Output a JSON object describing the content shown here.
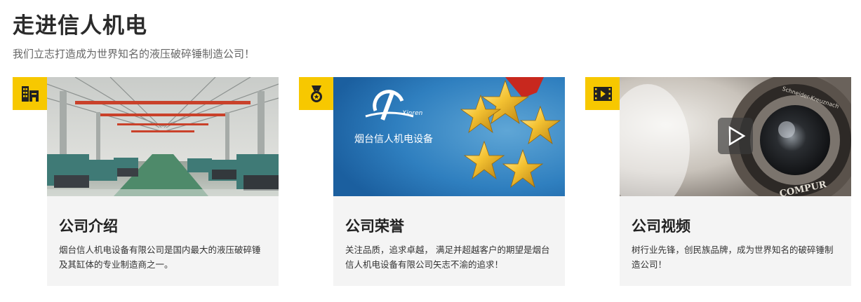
{
  "header": {
    "title": "走进信人机电",
    "subtitle": "我们立志打造成为世界知名的液压破碎锤制造公司！"
  },
  "cards": [
    {
      "icon": "building-icon",
      "image": "factory-floor-photo",
      "title": "公司介绍",
      "text": "烟台信人机电设备有限公司是国内最大的液压破碎锤及其缸体的专业制造商之一。"
    },
    {
      "icon": "medal-icon",
      "image": "honor-stars-photo",
      "image_brand": "Xinren",
      "image_caption": "烟台信人机电设备",
      "title": "公司荣誉",
      "text": "关注品质，追求卓越， 满足并超越客户的期望是烟台信人机电设备有限公司矢志不渝的追求！"
    },
    {
      "icon": "film-icon",
      "image": "camera-lens-photo",
      "image_lens_text": "Schneider-Kreuznach",
      "image_lens_text2": "COMPUR",
      "title": "公司视频",
      "text": "树行业先锋，创民族品牌，成为世界知名的破碎锤制造公司！"
    }
  ],
  "colors": {
    "badge": "#f7c800",
    "card_body": "#f4f4f4",
    "title": "#2b2b2b",
    "subtitle": "#666666"
  }
}
